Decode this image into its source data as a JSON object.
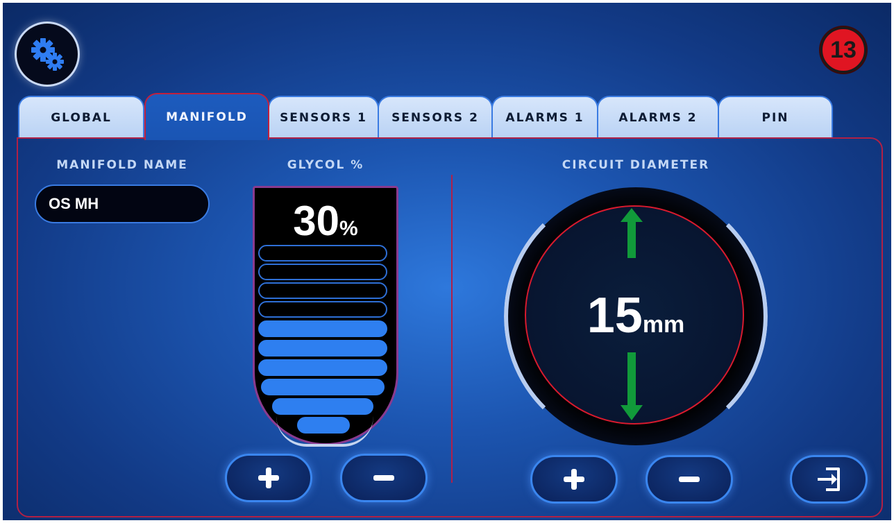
{
  "header": {
    "settings_icon": "gears-icon",
    "badge_count": "13"
  },
  "tabs": [
    {
      "label": "GLOBAL",
      "active": false
    },
    {
      "label": "MANIFOLD",
      "active": true
    },
    {
      "label": "SENSORS 1",
      "active": false
    },
    {
      "label": "SENSORS 2",
      "active": false
    },
    {
      "label": "ALARMS 1",
      "active": false
    },
    {
      "label": "ALARMS 2",
      "active": false
    },
    {
      "label": "PIN",
      "active": false
    }
  ],
  "manifold": {
    "name_label": "MANIFOLD NAME",
    "name_value": "OS MH"
  },
  "glycol": {
    "label": "GLYCOL %",
    "value": "30",
    "unit": "%",
    "segments_total": 10,
    "segments_filled": 6,
    "plus_icon": "plus-icon",
    "minus_icon": "minus-icon"
  },
  "circuit": {
    "label": "CIRCUIT DIAMETER",
    "value": "15",
    "unit": "mm",
    "plus_icon": "plus-icon",
    "minus_icon": "minus-icon"
  },
  "exit_icon": "exit-icon",
  "colors": {
    "accent_blue": "#2e7ff0",
    "badge_red": "#e01522",
    "arrow_green": "#119a3a",
    "border_red": "#b12045"
  }
}
